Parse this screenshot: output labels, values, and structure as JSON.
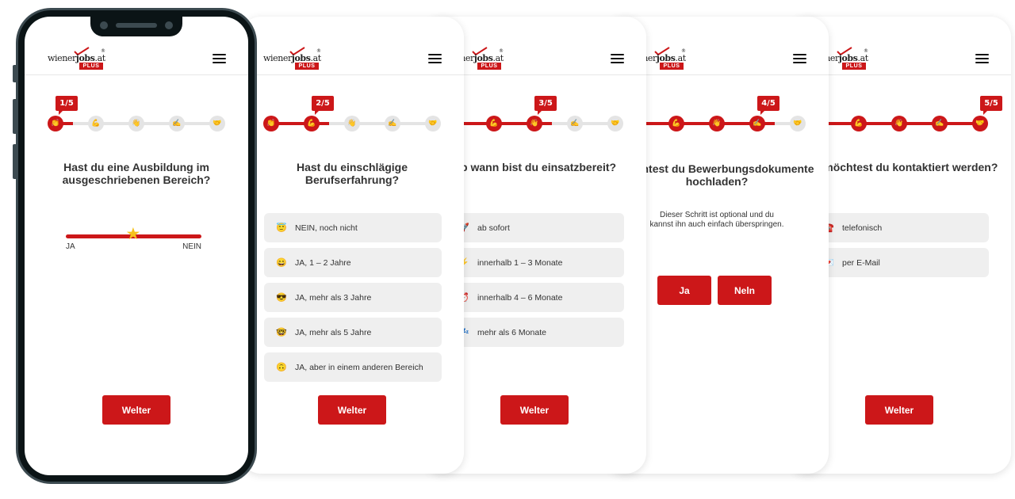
{
  "brand": {
    "logo_word_regular": "wiener",
    "logo_word_bold": "jobs",
    "logo_word_suffix": ".at",
    "logo_badge": "PLUS",
    "logo_registered": "®",
    "accent_color": "#cc1719"
  },
  "step_icons": [
    "👏",
    "💪",
    "👋",
    "✍️",
    "🤝"
  ],
  "screens": [
    {
      "step_label": "1/5",
      "current_step": 1,
      "question": "Hast du eine Ausbildung im ausgeschriebenen Bereich?",
      "slider": {
        "min_label": "JA",
        "max_label": "NEIN",
        "value_fraction": 0.5,
        "thumb_icon": "star-icon"
      },
      "next_label": "Welter"
    },
    {
      "step_label": "2/5",
      "current_step": 2,
      "question": "Hast du einschlägige Berufserfahrung?",
      "options": [
        {
          "icon": "😇",
          "label": "NEIN, noch nicht"
        },
        {
          "icon": "😄",
          "label": "JA, 1 – 2 Jahre"
        },
        {
          "icon": "😎",
          "label": "JA, mehr als 3 Jahre"
        },
        {
          "icon": "🤓",
          "label": "JA, mehr als 5 Jahre"
        },
        {
          "icon": "🙃",
          "label": "JA, aber in einem anderen Bereich"
        }
      ],
      "next_label": "Welter"
    },
    {
      "step_label": "3/5",
      "current_step": 3,
      "question": "Ab wann bist du einsatzbereit?",
      "options": [
        {
          "icon": "🚀",
          "label": "ab sofort"
        },
        {
          "icon": "⚡",
          "label": "innerhalb 1 – 3 Monate"
        },
        {
          "icon": "⏰",
          "label": "innerhalb 4 – 6 Monate"
        },
        {
          "icon": "💤",
          "label": "mehr als 6 Monate"
        }
      ],
      "next_label": "Welter"
    },
    {
      "step_label": "4/5",
      "current_step": 4,
      "question": "Möchtest du Bewerbungsdokumente hochladen?",
      "subtext": "Dieser Schritt ist optional und du kannst ihn auch einfach überspringen.",
      "yes_label": "Ja",
      "no_label": "Neln"
    },
    {
      "step_label": "5/5",
      "current_step": 5,
      "question": "Wie möchtest du kontaktiert werden?",
      "options": [
        {
          "icon": "☎️",
          "label": "telefonisch"
        },
        {
          "icon": "💌",
          "label": "per E-Mail"
        }
      ],
      "next_label": "Welter"
    }
  ]
}
